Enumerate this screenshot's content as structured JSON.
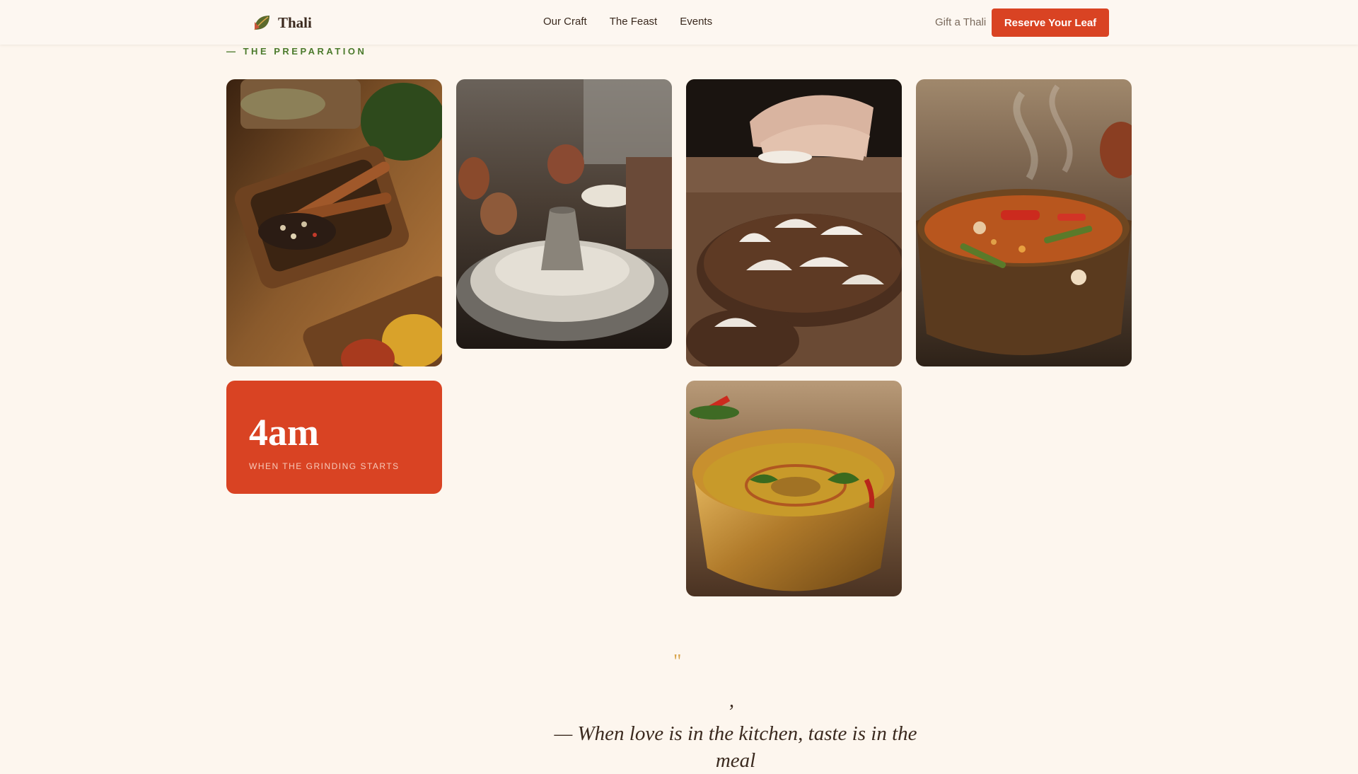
{
  "brand": {
    "name": "Thali",
    "logo_icon": "leaf-icon"
  },
  "nav": {
    "items": [
      {
        "label": "Our Craft"
      },
      {
        "label": "The Feast"
      },
      {
        "label": "Events"
      }
    ]
  },
  "header_actions": {
    "gift_label": "Gift a Thali",
    "reserve_label": "Reserve Your Leaf"
  },
  "preparation": {
    "section_label": "— THE PREPARATION",
    "stat": {
      "value": "4am",
      "label": "WHEN THE GRINDING STARTS"
    }
  },
  "quote": {
    "open_mark": "\"",
    "lead": ",",
    "text": "— When love is in the kitchen, taste is in the meal"
  },
  "colors": {
    "accent": "#d94323",
    "section_green": "#4b7a2c",
    "quote_gold": "#d8a44a",
    "background": "#fdf6ee"
  }
}
